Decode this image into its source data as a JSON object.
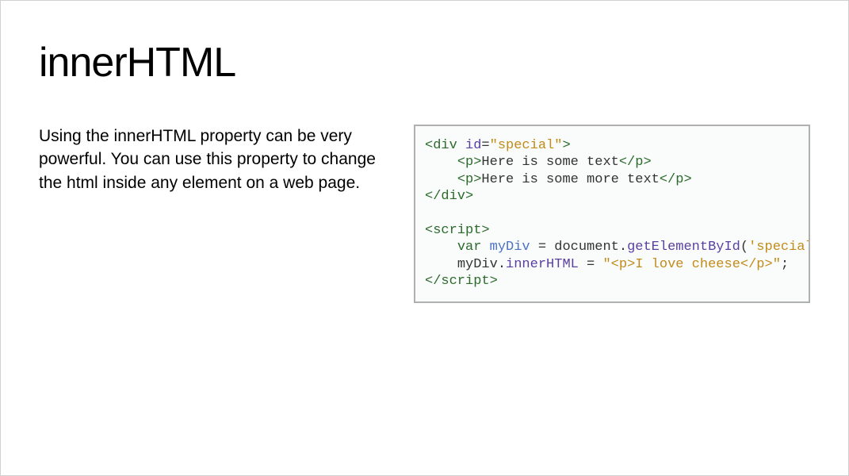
{
  "title": "innerHTML",
  "description": "Using the innerHTML property can be very powerful. You can use this property to change the html inside any element on a web page.",
  "code": {
    "tokens": [
      {
        "cls": "tag",
        "t": "<div"
      },
      {
        "cls": "punct",
        "t": " "
      },
      {
        "cls": "attr-name",
        "t": "id"
      },
      {
        "cls": "punct",
        "t": "="
      },
      {
        "cls": "attr-val",
        "t": "\"special\""
      },
      {
        "cls": "tag",
        "t": ">"
      },
      {
        "cls": "",
        "t": "\n    "
      },
      {
        "cls": "tag",
        "t": "<p>"
      },
      {
        "cls": "",
        "t": "Here is some text"
      },
      {
        "cls": "tag",
        "t": "</p>"
      },
      {
        "cls": "",
        "t": "\n    "
      },
      {
        "cls": "tag",
        "t": "<p>"
      },
      {
        "cls": "",
        "t": "Here is some more text"
      },
      {
        "cls": "tag",
        "t": "</p>"
      },
      {
        "cls": "",
        "t": "\n"
      },
      {
        "cls": "tag",
        "t": "</div>"
      },
      {
        "cls": "",
        "t": "\n\n"
      },
      {
        "cls": "tag",
        "t": "<script>"
      },
      {
        "cls": "",
        "t": "\n    "
      },
      {
        "cls": "keyword",
        "t": "var"
      },
      {
        "cls": "",
        "t": " "
      },
      {
        "cls": "varname",
        "t": "myDiv"
      },
      {
        "cls": "",
        "t": " = document."
      },
      {
        "cls": "method",
        "t": "getElementById"
      },
      {
        "cls": "",
        "t": "("
      },
      {
        "cls": "string",
        "t": "'special'"
      },
      {
        "cls": "",
        "t": ");\n    "
      },
      {
        "cls": "",
        "t": "myDiv."
      },
      {
        "cls": "method",
        "t": "innerHTML"
      },
      {
        "cls": "",
        "t": " = "
      },
      {
        "cls": "string",
        "t": "\"<p>I love cheese</p>\""
      },
      {
        "cls": "",
        "t": ";\n"
      },
      {
        "cls": "tag",
        "t": "</scr"
      },
      {
        "cls": "tag",
        "t": "ipt>"
      }
    ]
  }
}
